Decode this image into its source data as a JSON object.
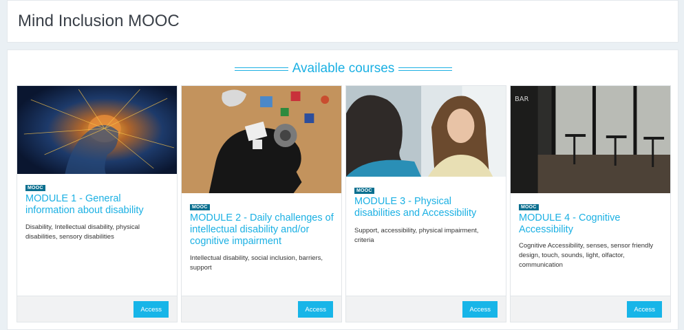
{
  "header": {
    "title": "Mind Inclusion MOOC"
  },
  "section": {
    "title": "Available courses"
  },
  "courses": [
    {
      "badge": "MOOC",
      "title": "MODULE 1 - General information about disability",
      "tags": "Disability, Intellectual disability, physical disabilities, sensory disabilities",
      "access_label": "Access"
    },
    {
      "badge": "MOOC",
      "title": "MODULE 2 - Daily challenges of intellectual disability and/or cognitive impairment",
      "tags": "Intellectual disability, social inclusion, barriers, support",
      "access_label": "Access"
    },
    {
      "badge": "MOOC",
      "title": "MODULE 3 - Physical disabilities and Accessibility",
      "tags": "Support, accessibility, physical impairment, criteria",
      "access_label": "Access"
    },
    {
      "badge": "MOOC",
      "title": "MODULE 4 - Cognitive Accessibility",
      "tags": "Cognitive Accessibility, senses, sensor friendly design, touch, sounds, light, olfactor, communication",
      "access_label": "Access"
    }
  ],
  "colors": {
    "accent": "#1bb0e3",
    "badge": "#0a6f8f",
    "button": "#17b5e8"
  }
}
